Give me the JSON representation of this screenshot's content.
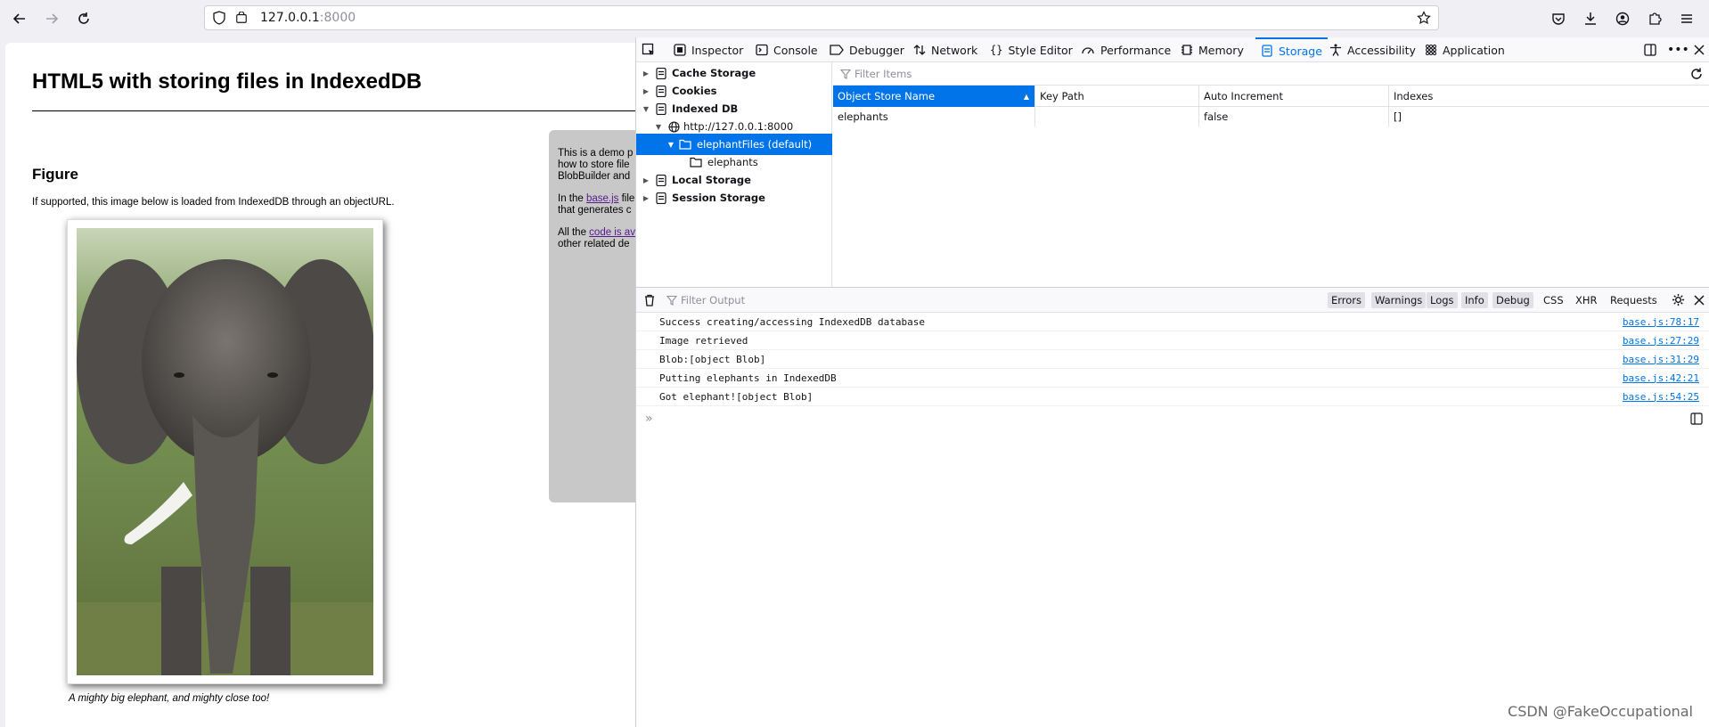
{
  "browser": {
    "url_host": "127.0.0.1",
    "url_port": ":8000"
  },
  "page": {
    "title": "HTML5 with storing files in IndexedDB",
    "section_heading": "Figure",
    "intro": "If supported, this image below is loaded from IndexedDB through an objectURL.",
    "caption": "A mighty big elephant, and mighty close too!",
    "sidebar": {
      "p1_l1": "This is a demo p",
      "p1_l2": "how to store file",
      "p1_l3": "BlobBuilder and",
      "p2_before": "In the ",
      "p2_link": "base.js",
      "p2_after": " file",
      "p2_l2": "that generates c",
      "p3_before": "All the ",
      "p3_link": "code is av",
      "p3_l2": "other related de"
    }
  },
  "devtools": {
    "tabs": [
      "Inspector",
      "Console",
      "Debugger",
      "Network",
      "Style Editor",
      "Performance",
      "Memory",
      "Storage",
      "Accessibility",
      "Application"
    ],
    "selected_tab": "Storage",
    "accent": "#0074e8",
    "storage_tree": {
      "cache_storage": "Cache Storage",
      "cookies": "Cookies",
      "indexed_db": "Indexed DB",
      "origin": "http://127.0.0.1:8000",
      "database": "elephantFiles (default)",
      "object_store": "elephants",
      "local_storage": "Local Storage",
      "session_storage": "Session Storage"
    },
    "table": {
      "filter_placeholder": "Filter Items",
      "columns": [
        "Object Store Name",
        "Key Path",
        "Auto Increment",
        "Indexes"
      ],
      "rows": [
        [
          "elephants",
          "",
          "false",
          "[]"
        ]
      ]
    },
    "console": {
      "filter_placeholder": "Filter Output",
      "filters": [
        "Errors",
        "Warnings",
        "Logs",
        "Info",
        "Debug"
      ],
      "extra_filters": [
        "CSS",
        "XHR",
        "Requests"
      ],
      "messages": [
        {
          "text": "Success creating/accessing IndexedDB database",
          "source": "base.js:78:17"
        },
        {
          "text": "Image retrieved",
          "source": "base.js:27:29"
        },
        {
          "text": "Blob:[object Blob]",
          "source": "base.js:31:29"
        },
        {
          "text": "Putting elephants in IndexedDB",
          "source": "base.js:42:21"
        },
        {
          "text": "Got elephant![object Blob]",
          "source": "base.js:54:25"
        }
      ]
    }
  },
  "watermark": "CSDN @FakeOccupational"
}
